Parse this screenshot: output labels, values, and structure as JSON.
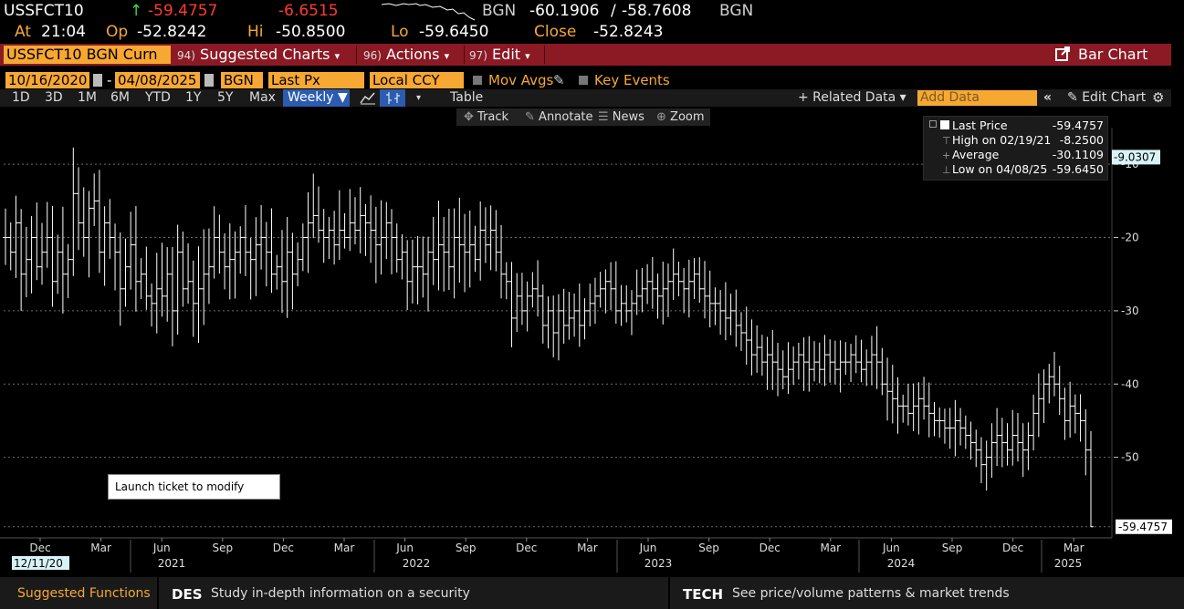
{
  "header": {
    "ticker": "USSFCT10",
    "up_arrow": "↑",
    "last": "-59.4757",
    "change": "-6.6515",
    "source": "BGN",
    "bid": "-60.1906",
    "slash": "/",
    "ask": "-58.7608",
    "source2": "BGN",
    "at_label": "At",
    "time": "21:04",
    "op_label": "Op",
    "open": "-52.8242",
    "hi_label": "Hi",
    "high": "-50.8500",
    "lo_label": "Lo",
    "low": "-59.6450",
    "close_label": "Close",
    "close": "-52.8243"
  },
  "toolbar": {
    "security": "USSFCT10 BGN Curn",
    "suggested_num": "94)",
    "suggested_label": "Suggested Charts",
    "actions_num": "96)",
    "actions_label": "Actions",
    "edit_num": "97)",
    "edit_label": "Edit",
    "bar_chart_label": "Bar Chart",
    "dropdown_glyph": "▾"
  },
  "settings": {
    "start_date": "10/16/2020",
    "dash": "-",
    "end_date": "04/08/2025",
    "source": "BGN",
    "field": "Last Px",
    "currency": "Local CCY",
    "mov_avgs": "Mov Avgs",
    "key_events": "Key Events"
  },
  "periods": [
    "1D",
    "3D",
    "1M",
    "6M",
    "YTD",
    "1Y",
    "5Y",
    "Max"
  ],
  "frequency": "Weekly ▼",
  "table_label": "Table",
  "related_data": "+ Related Data ▾",
  "add_data_placeholder": "Add Data",
  "edit_chart": "Edit Chart",
  "tools": {
    "track": "Track",
    "annotate": "Annotate",
    "news": "News",
    "zoom": "Zoom"
  },
  "legend": {
    "last_label": "Last Price",
    "last_value": "-59.4757",
    "high_label": "High on 02/19/21",
    "high_value": "-8.2500",
    "avg_label": "Average",
    "avg_value": "-30.1109",
    "low_label": "Low on 04/08/25",
    "low_value": "-59.6450"
  },
  "tooltip": "Launch ticket to modify route.",
  "chart_data": {
    "type": "bar",
    "subtype": "ohlc",
    "frequency": "weekly",
    "y_ticks": [
      -10,
      -20,
      -30,
      -40,
      -50
    ],
    "y_range": [
      -61,
      -5
    ],
    "x_month_ticks": [
      "Dec",
      "Mar",
      "Jun",
      "Sep",
      "Dec",
      "Mar",
      "Jun",
      "Sep",
      "Dec",
      "Mar",
      "Jun",
      "Sep",
      "Dec",
      "Mar",
      "Jun",
      "Sep",
      "Dec",
      "Mar"
    ],
    "x_year_ticks": [
      "2021",
      "2022",
      "2023",
      "2024",
      "2025"
    ],
    "first_date_label": "12/11/20",
    "last_price_tag": "-59.4757",
    "high_tag": "-9.0307",
    "color_grid": "#6a6a6a",
    "color_bars": "#ffffff",
    "series": [
      {
        "name": "USSFCT10",
        "values": [
          -20,
          -22,
          -18,
          -25,
          -23,
          -20,
          -24,
          -22,
          -20,
          -26,
          -22,
          -25,
          -23,
          -14,
          -18,
          -20,
          -16,
          -15,
          -22,
          -18,
          -20,
          -22,
          -27,
          -24,
          -21,
          -26,
          -25,
          -28,
          -29,
          -27,
          -28,
          -25,
          -30,
          -22,
          -27,
          -26,
          -29,
          -27,
          -25,
          -24,
          -20,
          -22,
          -24,
          -23,
          -22,
          -20,
          -22,
          -23,
          -21,
          -20,
          -22,
          -25,
          -24,
          -26,
          -22,
          -25,
          -23,
          -20,
          -18,
          -17,
          -19,
          -20,
          -19,
          -21,
          -19,
          -20,
          -18,
          -19,
          -17,
          -18,
          -19,
          -21,
          -20,
          -18,
          -20,
          -23,
          -22,
          -26,
          -24,
          -24,
          -25,
          -22,
          -23,
          -21,
          -22,
          -24,
          -20,
          -21,
          -22,
          -21,
          -23,
          -19,
          -21,
          -19,
          -22,
          -25,
          -26,
          -31,
          -28,
          -30,
          -28,
          -27,
          -28,
          -32,
          -30,
          -33,
          -30,
          -32,
          -31,
          -30,
          -32,
          -30,
          -29,
          -28,
          -27,
          -26,
          -27,
          -30,
          -29,
          -30,
          -29,
          -28,
          -27,
          -26,
          -27,
          -28,
          -27,
          -26,
          -25,
          -26,
          -27,
          -26,
          -25,
          -27,
          -28,
          -29,
          -29,
          -30,
          -31,
          -30,
          -32,
          -33,
          -34,
          -36,
          -35,
          -37,
          -36,
          -37,
          -38,
          -39,
          -38,
          -37,
          -36,
          -37,
          -38,
          -37,
          -38,
          -36,
          -37,
          -38,
          -37,
          -37,
          -36,
          -37,
          -38,
          -37,
          -36,
          -37,
          -40,
          -41,
          -42,
          -43,
          -43,
          -44,
          -43,
          -42,
          -43,
          -44,
          -45,
          -45,
          -46,
          -46,
          -45,
          -46,
          -47,
          -48,
          -49,
          -51,
          -50,
          -48,
          -47,
          -48,
          -49,
          -47,
          -48,
          -49,
          -47,
          -44,
          -42,
          -40,
          -39,
          -40,
          -42,
          -45,
          -43,
          -44,
          -45,
          -49,
          -59.4757
        ]
      }
    ]
  },
  "footer": {
    "suggested_functions": "Suggested Functions",
    "des_code": "DES",
    "des_text": "Study in-depth information on a security",
    "tech_code": "TECH",
    "tech_text": "See price/volume patterns & market trends"
  }
}
